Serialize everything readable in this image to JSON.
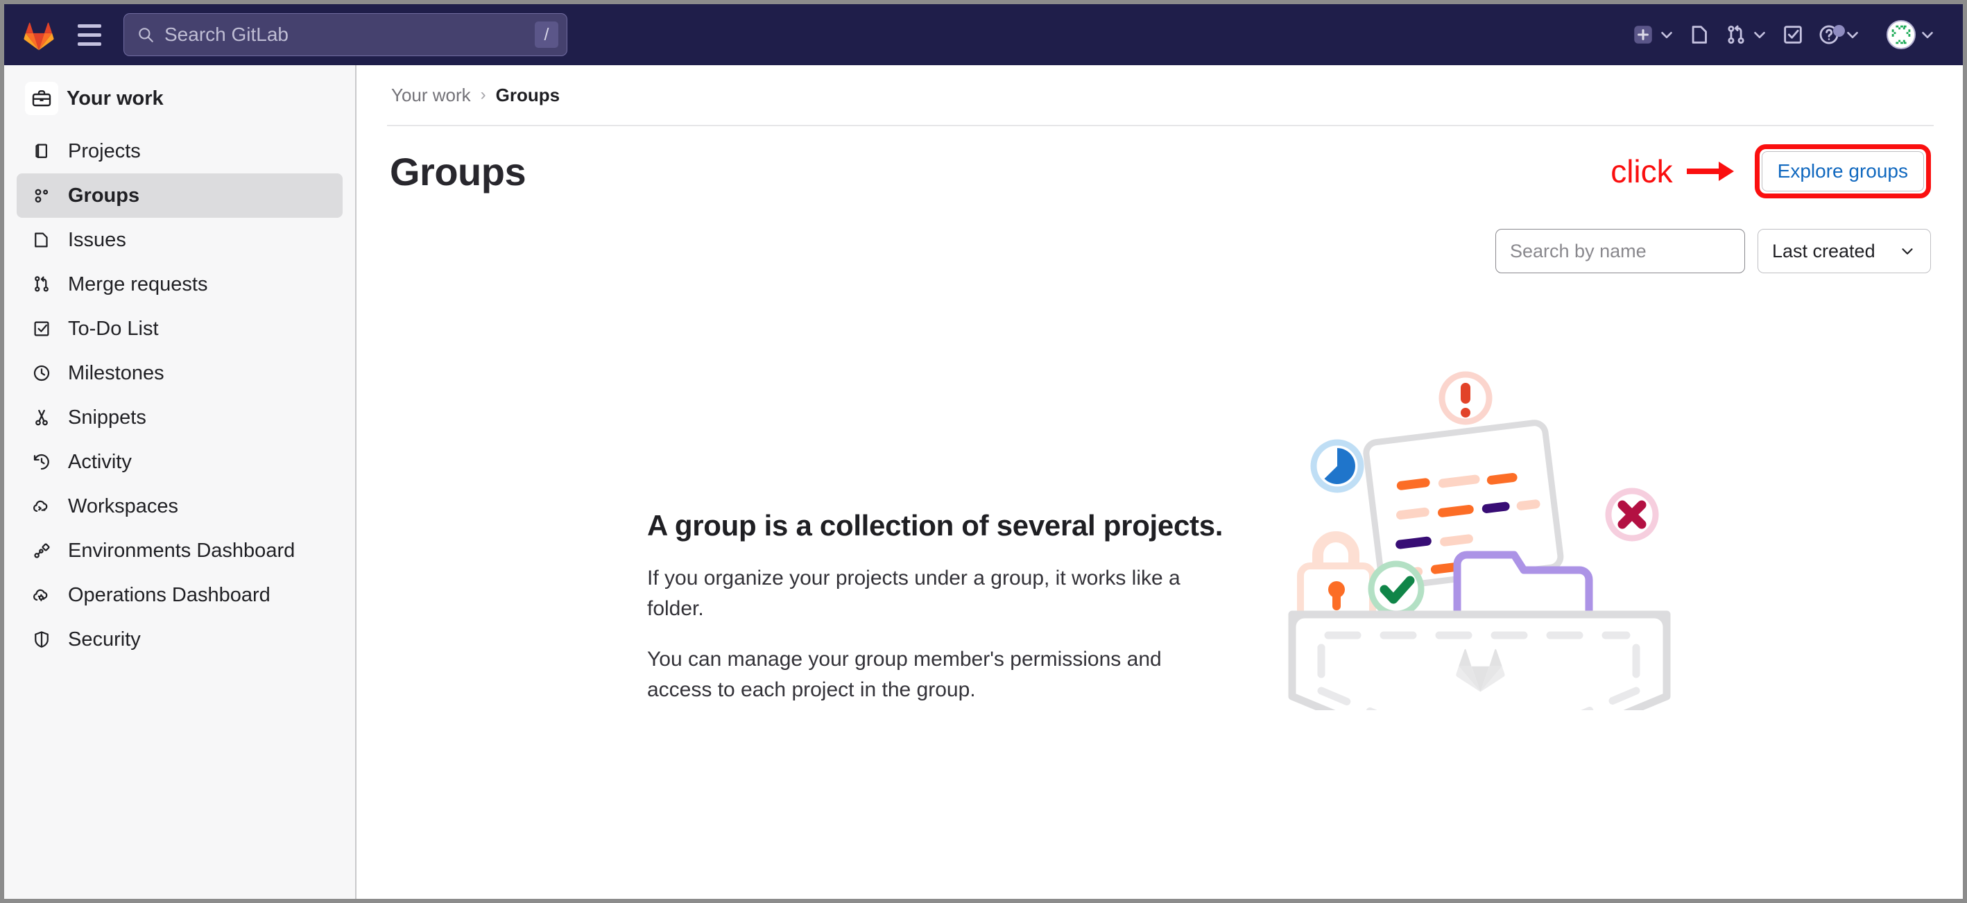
{
  "navbar": {
    "logo_icon": "gitlab-logo-icon",
    "menu_icon": "hamburger-menu-icon",
    "search": {
      "placeholder": "Search GitLab",
      "icon": "search-icon",
      "shortcut_key": "/"
    },
    "actions": [
      {
        "name": "create-new-menu",
        "icon": "plus-square-icon",
        "has_chevron": true
      },
      {
        "name": "issues-link",
        "icon": "issues-icon",
        "has_chevron": false
      },
      {
        "name": "merge-requests-menu",
        "icon": "merge-request-icon",
        "has_chevron": true
      },
      {
        "name": "todo-list-link",
        "icon": "todo-checkbox-icon",
        "has_chevron": false
      },
      {
        "name": "help-menu",
        "icon": "question-circle-icon",
        "has_chevron": true,
        "badge": true
      },
      {
        "name": "user-menu",
        "icon": "avatar-icon",
        "has_chevron": true
      }
    ]
  },
  "sidebar": {
    "header": {
      "label": "Your work",
      "icon": "briefcase-icon"
    },
    "items": [
      {
        "label": "Projects",
        "icon": "project-icon",
        "active": false
      },
      {
        "label": "Groups",
        "icon": "group-icon",
        "active": true
      },
      {
        "label": "Issues",
        "icon": "issues-icon",
        "active": false
      },
      {
        "label": "Merge requests",
        "icon": "merge-request-icon",
        "active": false
      },
      {
        "label": "To-Do List",
        "icon": "todo-checkbox-icon",
        "active": false
      },
      {
        "label": "Milestones",
        "icon": "clock-icon",
        "active": false
      },
      {
        "label": "Snippets",
        "icon": "scissors-icon",
        "active": false
      },
      {
        "label": "Activity",
        "icon": "history-icon",
        "active": false
      },
      {
        "label": "Workspaces",
        "icon": "cloud-terminal-icon",
        "active": false
      },
      {
        "label": "Environments Dashboard",
        "icon": "environment-icon",
        "active": false
      },
      {
        "label": "Operations Dashboard",
        "icon": "cloud-gear-icon",
        "active": false
      },
      {
        "label": "Security",
        "icon": "shield-icon",
        "active": false
      }
    ]
  },
  "breadcrumb": {
    "parent": "Your work",
    "separator": "›",
    "current": "Groups"
  },
  "page": {
    "title": "Groups",
    "explore_button": "Explore groups",
    "annotation_text": "click",
    "annotation_arrow": "→",
    "annotation_color": "#fa0f0f"
  },
  "filters": {
    "search_placeholder": "Search by name",
    "search_value": "",
    "sort_label": "Last created",
    "sort_chevron": "chevron-down-icon"
  },
  "empty_state": {
    "title": "A group is a collection of several projects.",
    "paragraph_1": "If you organize your projects under a group, it works like a folder.",
    "paragraph_2": "You can manage your group member's permissions and access to each project in the group.",
    "illustration": "groups-empty-pocket-illustration"
  },
  "colors": {
    "navbar_bg": "#1f1e4a",
    "sidebar_bg": "#f7f7f8",
    "sidebar_active_bg": "#dcdcde",
    "link_blue": "#1068bf",
    "annotation_red": "#fa0f0f",
    "gitlab_orange": "#e24329"
  }
}
